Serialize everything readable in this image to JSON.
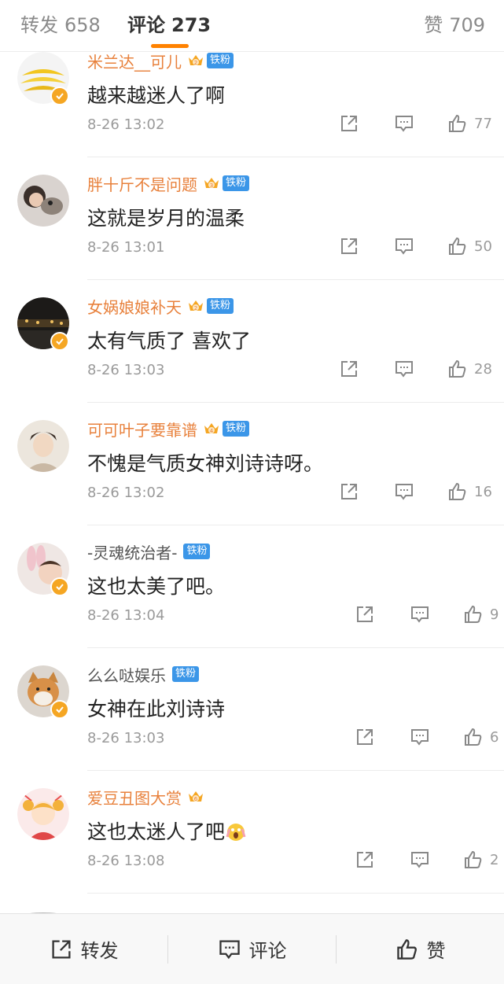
{
  "tabs": {
    "repost": {
      "label": "转发",
      "count": "658"
    },
    "comment": {
      "label": "评论",
      "count": "273"
    },
    "like": {
      "label": "赞",
      "count": "709"
    }
  },
  "colors": {
    "accent": "#ff8200",
    "username": "#e8813c",
    "fan_badge": "#3b96e8",
    "verified": "#f5a623"
  },
  "comments": [
    {
      "username": "米兰达__可儿",
      "crown_level": "2",
      "fan_badge": "铁粉",
      "text": "越来越迷人了啊",
      "time": "8-26 13:02",
      "likes": "77",
      "verified": true,
      "avatar": "bananas"
    },
    {
      "username": "胖十斤不是问题",
      "crown_level": "3",
      "fan_badge": "铁粉",
      "text": "这就是岁月的温柔",
      "time": "8-26 13:01",
      "likes": "50",
      "verified": false,
      "avatar": "girl-with-dog"
    },
    {
      "username": "女娲娘娘补天",
      "crown_level": "2",
      "fan_badge": "铁粉",
      "text": "太有气质了 喜欢了",
      "time": "8-26 13:03",
      "likes": "28",
      "verified": true,
      "avatar": "night-city"
    },
    {
      "username": "可可叶子要靠谱",
      "crown_level": "4",
      "fan_badge": "铁粉",
      "text": "不愧是气质女神刘诗诗呀。",
      "time": "8-26 13:02",
      "likes": "16",
      "verified": false,
      "avatar": "drawn-man"
    },
    {
      "username": "-灵魂统治者-",
      "crown_level": "",
      "fan_badge": "铁粉",
      "text": "这也太美了吧。",
      "time": "8-26 13:04",
      "likes": "9",
      "verified": true,
      "avatar": "baby-bunny"
    },
    {
      "username": "么么哒娱乐",
      "crown_level": "",
      "fan_badge": "铁粉",
      "text": "女神在此刘诗诗",
      "time": "8-26 13:03",
      "likes": "6",
      "verified": true,
      "avatar": "shiba-dog"
    },
    {
      "username": "爱豆丑图大赏",
      "crown_level": "6",
      "fan_badge": "",
      "text": "这也太迷人了吧",
      "emoji": "scream-emoji",
      "time": "8-26 13:08",
      "likes": "2",
      "verified": false,
      "avatar": "cartoon-girl"
    }
  ],
  "bottom_bar": {
    "repost": "转发",
    "comment": "评论",
    "like": "赞"
  }
}
